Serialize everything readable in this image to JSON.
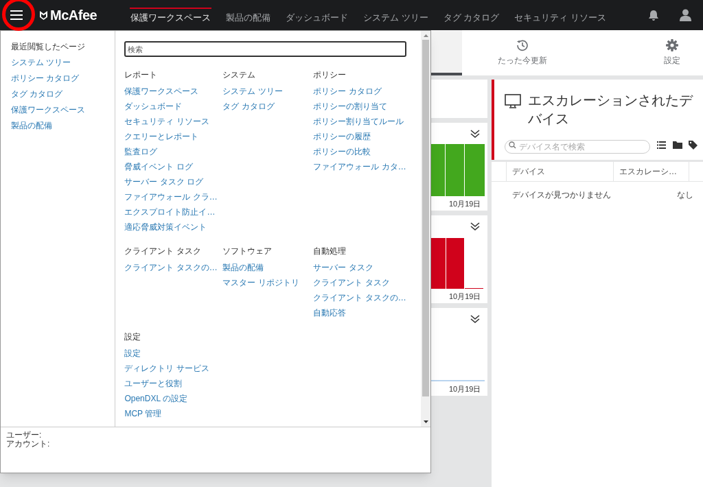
{
  "header": {
    "logo": "McAfee",
    "nav": [
      {
        "label": "保護ワークスペース",
        "selected": true
      },
      {
        "label": "製品の配備",
        "selected": false
      },
      {
        "label": "ダッシュボード",
        "selected": false
      },
      {
        "label": "システム ツリー",
        "selected": false
      },
      {
        "label": "タグ カタログ",
        "selected": false
      },
      {
        "label": "セキュリティ リソース",
        "selected": false
      }
    ]
  },
  "menu": {
    "recent": {
      "title": "最近閲覧したページ",
      "items": [
        "システム ツリー",
        "ポリシー カタログ",
        "タグ カタログ",
        "保護ワークスペース",
        "製品の配備"
      ]
    },
    "search": {
      "placeholder": "検索"
    },
    "sections": [
      {
        "title": "レポート",
        "items": [
          "保護ワークスペース",
          "ダッシュボード",
          "セキュリティ リソース",
          "クエリーとレポート",
          "監査ログ",
          "脅威イベント ログ",
          "サーバー タスク ログ",
          "ファイアウォール クラ…",
          "エクスプロイト防止イ…",
          "適応脅威対策イベント"
        ]
      },
      {
        "title": "システム",
        "items": [
          "システム ツリー",
          "タグ カタログ"
        ]
      },
      {
        "title": "ポリシー",
        "items": [
          "ポリシー カタログ",
          "ポリシーの割り当て",
          "ポリシー割り当てルール",
          "ポリシーの履歴",
          "ポリシーの比較",
          "ファイアウォール カタ…"
        ]
      },
      {
        "title": "クライアント タスク",
        "items": [
          "クライアント タスクの…"
        ]
      },
      {
        "title": "ソフトウェア",
        "items": [
          "製品の配備",
          "マスター リポジトリ"
        ]
      },
      {
        "title": "自動処理",
        "items": [
          "サーバー タスク",
          "クライアント タスク",
          "クライアント タスクの…",
          "自動応答"
        ]
      },
      {
        "title": "設定",
        "items": [
          "設定",
          "ディレクトリ サービス",
          "ユーザーと役割",
          "OpenDXL の設定",
          "MCP 管理"
        ]
      }
    ],
    "footer": {
      "user_label": "ユーザー:",
      "account_label": "アカウント:"
    }
  },
  "toolbar": {
    "refresh": "たった今更新",
    "settings": "設定"
  },
  "cards": [
    {
      "kind": "blank"
    },
    {
      "kind": "full",
      "color": "#43a81e",
      "date": "10月19日"
    },
    {
      "kind": "partial",
      "color": "#d0021b",
      "date": "10月19日"
    },
    {
      "kind": "flat",
      "color": "#b9d4ef",
      "date": "10月19日"
    }
  ],
  "panel": {
    "title": "エスカレーションされたデバイス",
    "search_placeholder": "デバイス名で検索",
    "columns": [
      "デバイス",
      "エスカレーシ…"
    ],
    "rows": [
      [
        "デバイスが見つかりません",
        "なし"
      ]
    ]
  }
}
